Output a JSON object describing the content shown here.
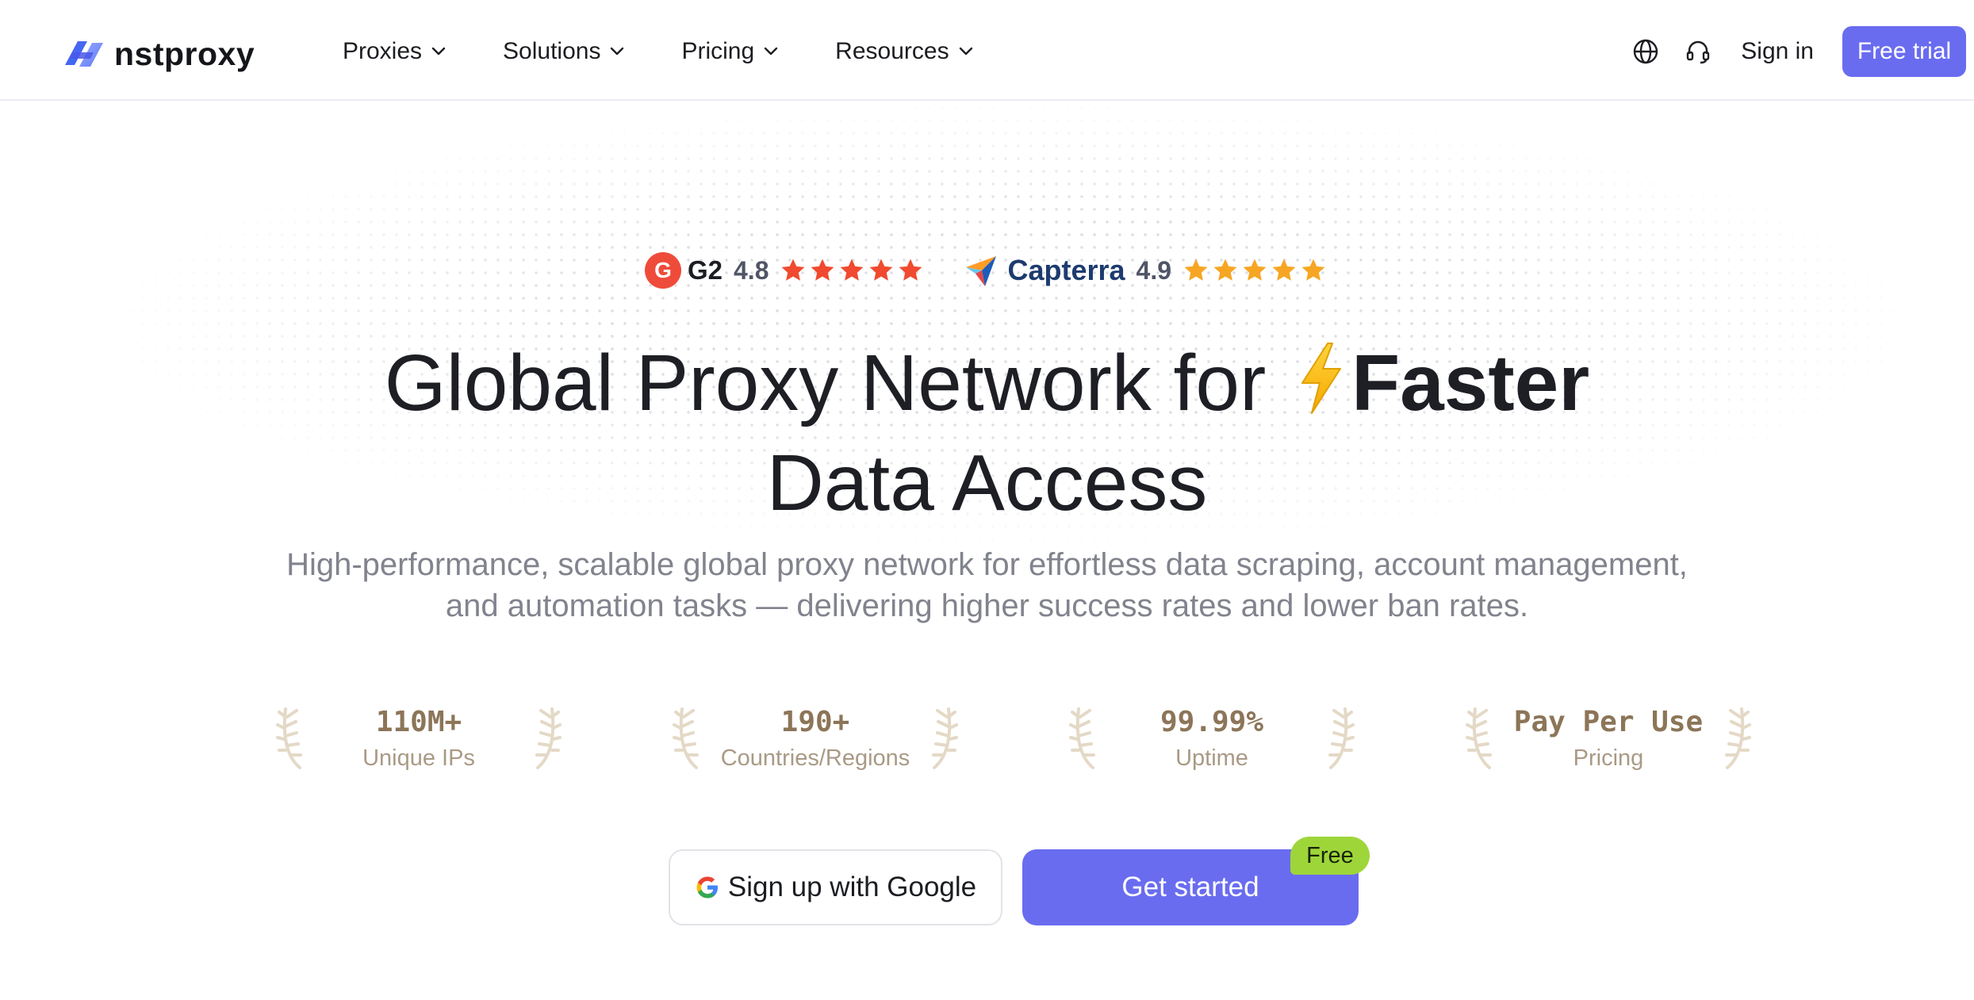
{
  "brand": {
    "name": "nstproxy",
    "accent": "#6a6cf0"
  },
  "nav": {
    "items": [
      {
        "label": "Proxies"
      },
      {
        "label": "Solutions"
      },
      {
        "label": "Pricing"
      },
      {
        "label": "Resources"
      }
    ],
    "icons": [
      "globe-icon",
      "headset-icon",
      "chevron-down-icon"
    ],
    "sign_in": "Sign in",
    "free_trial": "Free trial"
  },
  "ratings": [
    {
      "platform": "G2",
      "badge": "G",
      "score": "4.8",
      "stars": 5,
      "star_color": "#f04a2f"
    },
    {
      "platform": "Capterra",
      "score": "4.9",
      "stars": 5,
      "star_color": "#f6a623"
    }
  ],
  "hero": {
    "title_line1": "Global Proxy Network for",
    "title_emphasis": "Faster",
    "title_line2": "Data Access",
    "subtitle_line1": "High-performance, scalable global proxy network for effortless data scraping, account management,",
    "subtitle_line2": "and automation tasks — delivering higher success rates and lower ban rates."
  },
  "stats": [
    {
      "value": "110M+",
      "label": "Unique IPs"
    },
    {
      "value": "190+",
      "label": "Countries/Regions"
    },
    {
      "value": "99.99%",
      "label": "Uptime"
    },
    {
      "value": "Pay Per Use",
      "label": "Pricing"
    }
  ],
  "cta": {
    "google": "Sign up with Google",
    "start": "Get started",
    "badge": "Free",
    "badge_color": "#9ed63a"
  }
}
